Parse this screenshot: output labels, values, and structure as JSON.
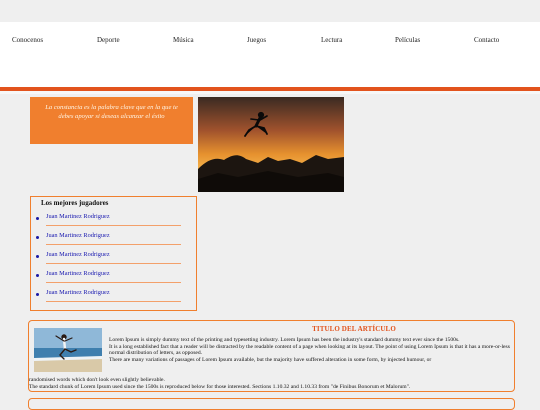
{
  "nav": {
    "items": [
      "Conocenos",
      "Deporte",
      "Música",
      "Juegos",
      "Lectura",
      "Películas",
      "Contacto"
    ]
  },
  "quote": {
    "text": "La constancia es la palabra clave que en la que te debes apoyar si deseas alcanzar el éxito"
  },
  "players": {
    "title": "Los mejores jugadores",
    "items": [
      "Juan Martinez Rodriguez",
      "Juan Martinez Rodriguez",
      "Juan Martinez Rodriguez",
      "Juan Martinez Rodriguez",
      "Juan Martinez Rodriguez"
    ]
  },
  "article": {
    "title": "TITULO DEL ARTÍCULO",
    "p1": "Lorem Ipsum is simply dummy text of the printing and typesetting industry. Lorem Ipsum has been the industry's standard dummy text ever since the 1500s.",
    "p2": "It is a long established fact that a reader will be distracted by the readable content of a page when looking at its layout. The point of using Lorem Ipsum is that it has a more-or-less normal distribution of letters, as opposed.",
    "p3": "There are many variations of passages of Lorem Ipsum available, but the majority have suffered alteration in some form, by injected humour, or",
    "p3b": "randomised words which don't look even slightly believable.",
    "p4": "The standard chunk of Lorem Ipsum used since the 1500s is reproduced below for those interested. Sections 1.10.32 and 1.10.33 from \"de Finibus Bonorum et Malorum\"."
  },
  "colors": {
    "accent": "#e2531d",
    "quote_bg": "#f07f2e",
    "link": "#1a1ab0",
    "page_bg": "#efefef"
  },
  "icons": {
    "hero": "silhouette-jumper-sunset-image",
    "article": "beach-jumper-image"
  }
}
